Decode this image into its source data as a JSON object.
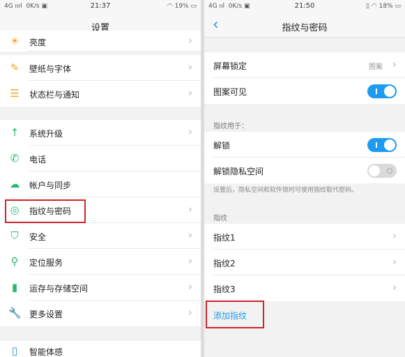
{
  "left": {
    "status": {
      "signal": "4G ıııl",
      "speed": "0K/s",
      "time": "21:37",
      "battery": "19%"
    },
    "title": "设置",
    "items": [
      {
        "label": "亮度",
        "icon": "brightness-icon",
        "color": "#f5a623"
      },
      {
        "label": "壁纸与字体",
        "icon": "brush-icon",
        "color": "#f5a623"
      },
      {
        "label": "状态栏与通知",
        "icon": "list-icon",
        "color": "#f5a623"
      },
      {
        "label": "系统升级",
        "icon": "arrow-up-icon",
        "color": "#2bb673"
      },
      {
        "label": "电话",
        "icon": "phone-icon",
        "color": "#2bb673"
      },
      {
        "label": "帐户与同步",
        "icon": "cloud-icon",
        "color": "#2bb673"
      },
      {
        "label": "指纹与密码",
        "icon": "fingerprint-icon",
        "color": "#2bb673"
      },
      {
        "label": "安全",
        "icon": "shield-icon",
        "color": "#2bb673"
      },
      {
        "label": "定位服务",
        "icon": "location-icon",
        "color": "#2bb673"
      },
      {
        "label": "运存与存储空间",
        "icon": "storage-icon",
        "color": "#2bb673"
      },
      {
        "label": "更多设置",
        "icon": "wrench-icon",
        "color": "#2bb673"
      },
      {
        "label": "智能体感",
        "icon": "motion-icon",
        "color": "#2a8fe6"
      }
    ]
  },
  "right": {
    "status": {
      "signal": "4G ııl",
      "speed": "0K/s",
      "time": "21:50",
      "battery": "18%"
    },
    "title": "指纹与密码",
    "screen_lock": {
      "label": "屏幕锁定",
      "value": "图案"
    },
    "pattern_visible": {
      "label": "图案可见",
      "state": "on"
    },
    "section_use": "指纹用于：",
    "unlock": {
      "label": "解锁",
      "state": "on"
    },
    "privacy": {
      "label": "解锁隐私空间",
      "state": "off"
    },
    "note": "设置后，隐私空间和软件锁时可使用指纹取代密码。",
    "section_fp": "指纹",
    "fingerprints": [
      "指纹1",
      "指纹2",
      "指纹3"
    ],
    "add_label": "添加指纹",
    "accent": "#1d9bf0",
    "highlight_color": "#d0242b"
  }
}
